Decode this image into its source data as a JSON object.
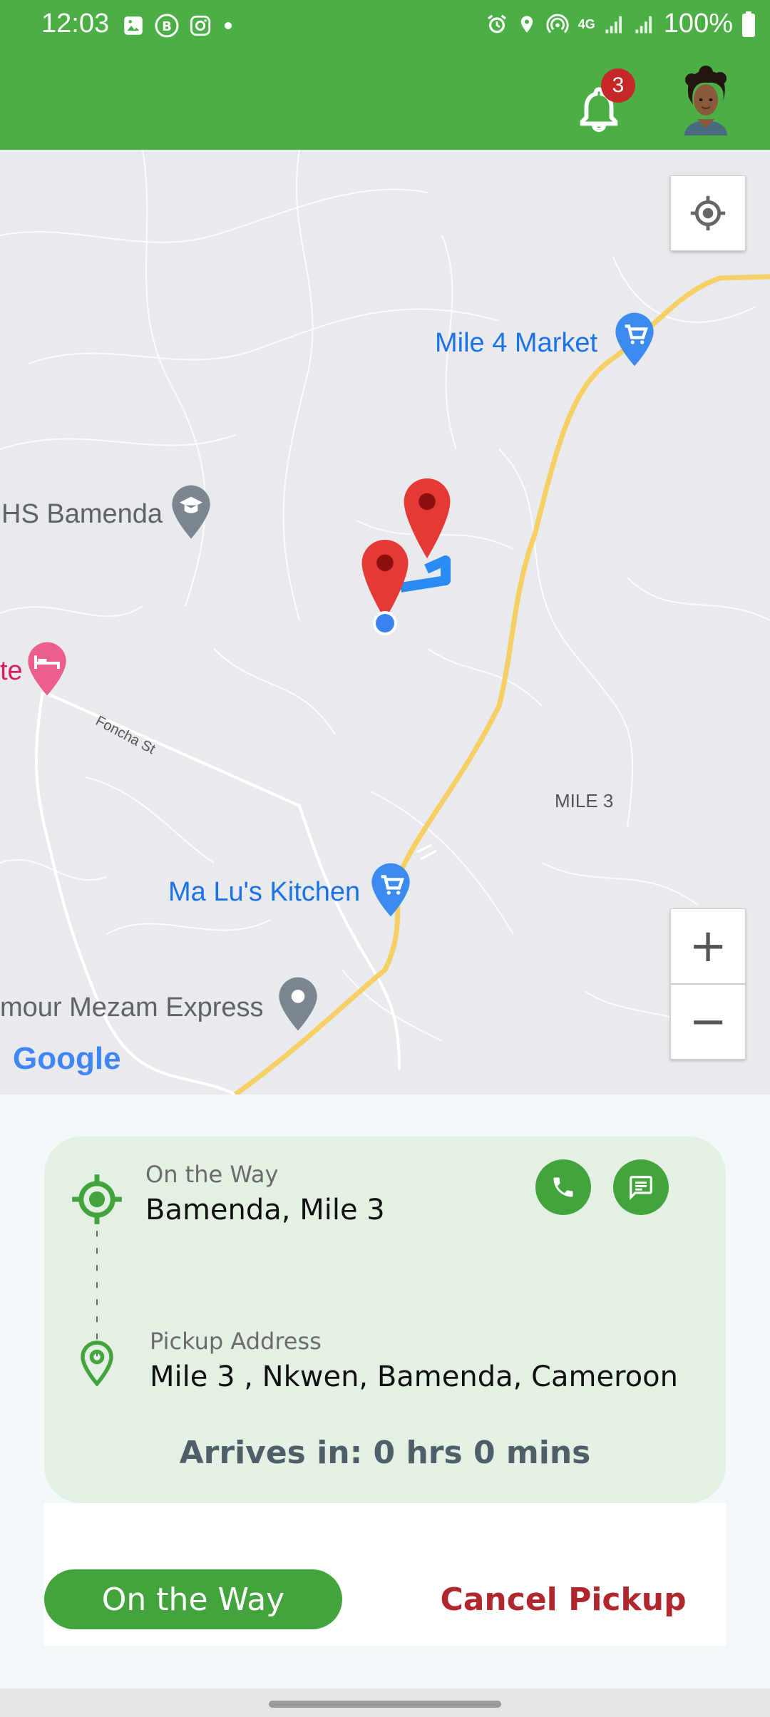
{
  "status_bar": {
    "time": "12:03",
    "battery": "100%",
    "network": "4G"
  },
  "app_bar": {
    "notification_count": "3"
  },
  "map": {
    "places": [
      {
        "label": "Mile 4 Market",
        "icon": "cart-pin-icon"
      },
      {
        "label": "HS Bamenda",
        "icon": "school-pin-icon"
      },
      {
        "label": "te",
        "icon": "hotel-pin-icon"
      },
      {
        "label": "Foncha St",
        "icon": ""
      },
      {
        "label": "MILE 3",
        "icon": ""
      },
      {
        "label": "Ma Lu's Kitchen",
        "icon": "cart-pin-icon"
      },
      {
        "label": "mour Mezam Express",
        "icon": "place-pin-icon"
      }
    ],
    "attribution": "Google",
    "zoom_in": "+",
    "zoom_out": "−",
    "colors": {
      "road_major": "#f6cf65",
      "route": "#2a8bf2",
      "marker": "#e53935",
      "accent": "#4caf45"
    }
  },
  "trip": {
    "status_label": "On the Way",
    "current_location": "Bamenda, Mile 3",
    "pickup_label": "Pickup Address",
    "pickup_address": "Mile 3 , Nkwen, Bamenda, Cameroon",
    "eta": "Arrives in: 0 hrs 0 mins"
  },
  "actions": {
    "primary": "On the Way",
    "cancel": "Cancel Pickup"
  }
}
